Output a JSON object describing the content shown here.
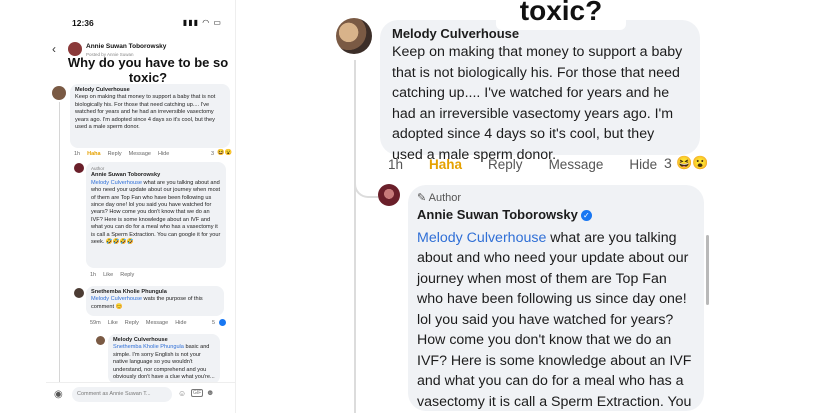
{
  "phone": {
    "status_time": "12:36",
    "status_icons": "▮▮▮ ◠ ▭",
    "header_author": "Annie Suwan Toborowsky",
    "header_sub": "Posted by Annie Suwan",
    "caption": "Why do you have to be so toxic?",
    "comment1": {
      "name": "Melody Culverhouse",
      "text": "Keep on making that money to support a baby that is not biologically his. For those that need catching up.... I've watched for years and he had an irreversible vasectomy years ago. I'm adopted since 4 days so it's cool, but they used a male sperm donor.",
      "time": "1h",
      "haha": "Haha",
      "reply": "Reply",
      "message": "Message",
      "hide": "Hide",
      "count": "3"
    },
    "comment2": {
      "author_tag": "Author",
      "name": "Annie Suwan Toborowsky",
      "mention": "Melody Culverhouse",
      "text": " what are you talking about and who need your update about our journey when most of them are Top Fan who have been following us since day one! lol you said you have watched for years? How come you don't know that we do an IVF? Here is some knowledge about an IVF and what you can do for a meal who has a vasectomy it is call a Sperm Extraction. You can google it for your seek. 🤣🤣🤣🤣",
      "time": "1h",
      "like": "Like",
      "reply": "Reply"
    },
    "comment3": {
      "name": "Snethemba Kholie Phungula",
      "mention": "Melody Culverhouse",
      "text": " wats the purpose of this comment 😊",
      "time": "59m",
      "like": "Like",
      "reply": "Reply",
      "message": "Message",
      "hide": "Hide",
      "count": "5"
    },
    "comment4": {
      "name": "Melody Culverhouse",
      "mention": "Snethemba Kholie Phungula",
      "text": " basic and simple. I'm sorry English is not your native language so you wouldn't understand, nor comprehend and you obviously don't have a clue what you're..."
    },
    "comment_placeholder": "Comment as Annie Suwan T...",
    "icons": {
      "camera": "camera-icon",
      "sticker": "sticker-icon",
      "gif": "GIF",
      "emoji": "emoji-icon"
    }
  },
  "zoom": {
    "caption": "toxic?",
    "comment1": {
      "name": "Melody Culverhouse",
      "text": "Keep on making that money to support a baby that is not biologically his. For those that need catching up.... I've watched for years and he had an irreversible vasectomy years ago. I'm adopted since 4 days so it's cool, but they used a male sperm donor.",
      "time": "1h",
      "haha": "Haha",
      "reply": "Reply",
      "message": "Message",
      "hide": "Hide",
      "count": "3",
      "reactions": "😆😮"
    },
    "comment2": {
      "author_tag": "✎ Author",
      "name": "Annie Suwan Toborowsky",
      "mention": "Melody Culverhouse",
      "text": " what are you talking about and who need your update about our journey when most of them are Top Fan who have been following us since day one! lol you said you have watched for years? How come you don't know that we do an IVF? Here is some knowledge about an IVF and what you can do for a meal who has a vasectomy it is call a Sperm Extraction. You can google it for your seek. 🤣🤣🤣🤣"
    }
  },
  "colors": {
    "link": "#2f6fd6",
    "haha": "#e5a100",
    "bubble": "#f0f2f5",
    "verified": "#1877f2"
  }
}
